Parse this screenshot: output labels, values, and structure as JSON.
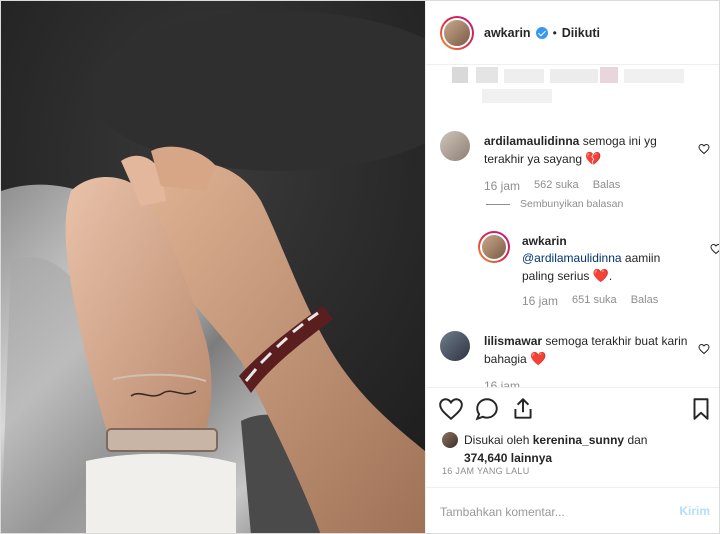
{
  "header": {
    "username": "awkarin",
    "separator": "•",
    "follow_status": "Diikuti"
  },
  "comments": [
    {
      "username": "ardilamaulidinna",
      "text": "semoga ini yg terakhir ya sayang",
      "emoji": "💔",
      "time": "16 jam",
      "likes": "562 suka",
      "reply_label": "Balas",
      "hide_replies": "Sembunyikan balasan"
    },
    {
      "username": "awkarin",
      "mention": "@ardilamaulidinna",
      "text": "aamiin paling serius",
      "emoji": "❤️",
      "trailing": ".",
      "time": "16 jam",
      "likes": "651 suka",
      "reply_label": "Balas"
    },
    {
      "username": "lilismawar",
      "text": "semoga terakhir buat karin bahagia",
      "emoji": "❤️",
      "time": "16 jam"
    }
  ],
  "icons": {
    "like": "heart-outline-icon",
    "comment": "comment-bubble-icon",
    "share": "share-upload-icon",
    "save": "bookmark-icon",
    "verified": "verified-badge-icon"
  },
  "likes": {
    "prefix": "Disukai oleh",
    "user": "kerenina_sunny",
    "conj": "dan",
    "count": "374,640",
    "suffix": "lainnya"
  },
  "timestamp": "16 JAM YANG LALU",
  "comment_box": {
    "placeholder": "Tambahkan komentar...",
    "post_label": "Kirim"
  },
  "colors": {
    "verified": "#3897f0",
    "post_disabled": "#b2dffc",
    "heart": "#d9232d"
  }
}
